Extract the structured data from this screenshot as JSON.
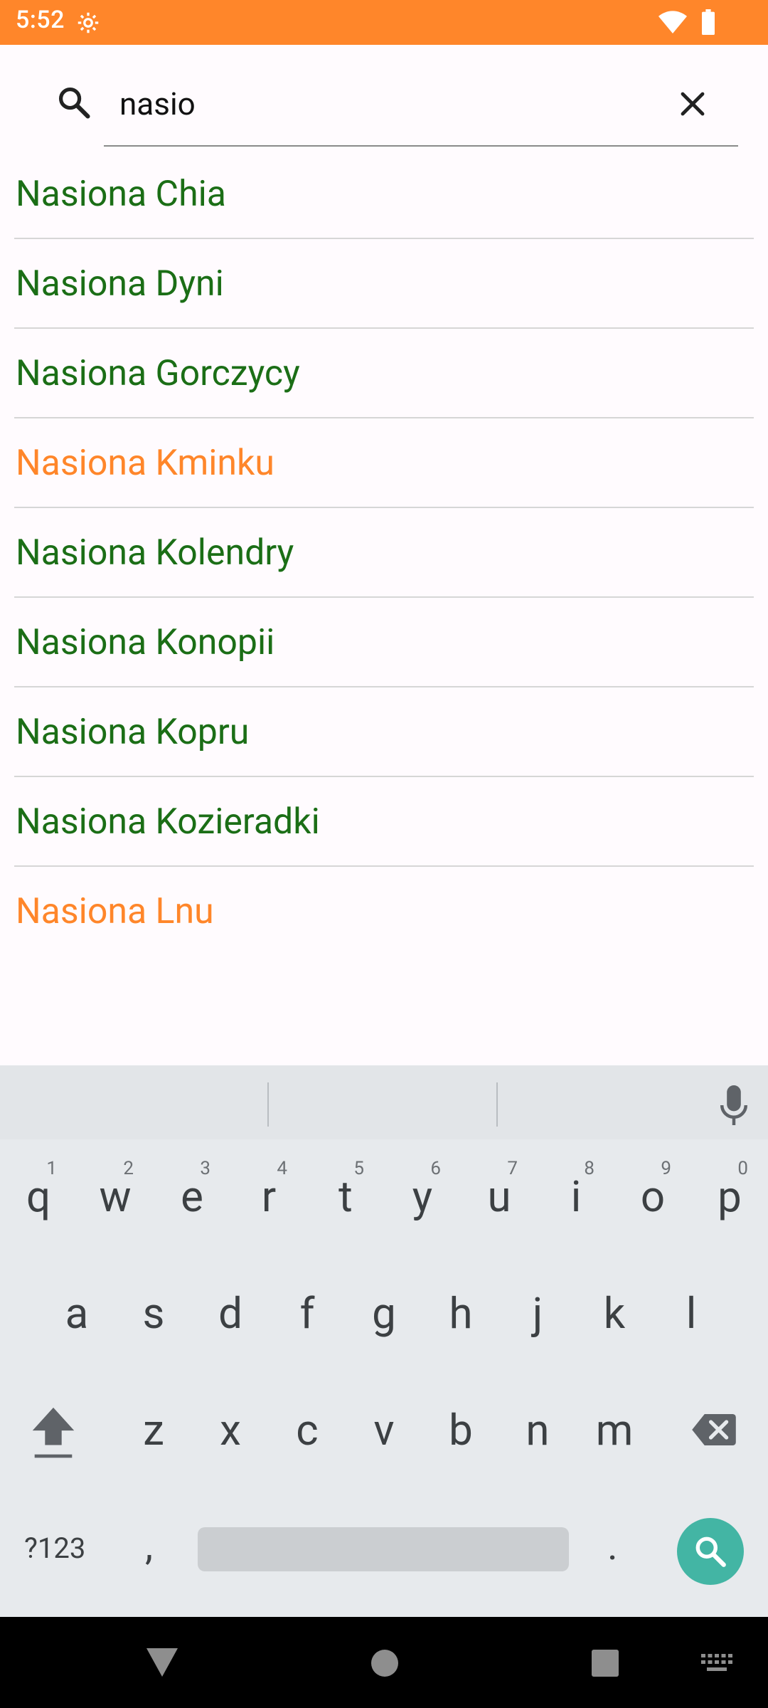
{
  "status_bar": {
    "time": "5:52"
  },
  "search": {
    "query": "nasio"
  },
  "results": [
    {
      "label": "Nasiona Chia",
      "color": "#1b6e16"
    },
    {
      "label": "Nasiona Dyni",
      "color": "#1b6e16"
    },
    {
      "label": "Nasiona Gorczycy",
      "color": "#1b6e16"
    },
    {
      "label": "Nasiona Kminku",
      "color": "#ff862a"
    },
    {
      "label": "Nasiona Kolendry",
      "color": "#1b6e16"
    },
    {
      "label": "Nasiona Konopii",
      "color": "#1b6e16"
    },
    {
      "label": "Nasiona Kopru",
      "color": "#1b6e16"
    },
    {
      "label": "Nasiona Kozieradki",
      "color": "#1b6e16"
    },
    {
      "label": "Nasiona Lnu",
      "color": "#ff862a"
    }
  ],
  "keyboard": {
    "row1": [
      {
        "k": "q",
        "n": "1"
      },
      {
        "k": "w",
        "n": "2"
      },
      {
        "k": "e",
        "n": "3"
      },
      {
        "k": "r",
        "n": "4"
      },
      {
        "k": "t",
        "n": "5"
      },
      {
        "k": "y",
        "n": "6"
      },
      {
        "k": "u",
        "n": "7"
      },
      {
        "k": "i",
        "n": "8"
      },
      {
        "k": "o",
        "n": "9"
      },
      {
        "k": "p",
        "n": "0"
      }
    ],
    "row2": [
      "a",
      "s",
      "d",
      "f",
      "g",
      "h",
      "j",
      "k",
      "l"
    ],
    "row3": [
      "z",
      "x",
      "c",
      "v",
      "b",
      "n",
      "m"
    ],
    "symbols_label": "?123",
    "comma": ",",
    "period": "."
  },
  "colors": {
    "status_bar": "#ff862a",
    "item_default": "#1b6e16",
    "item_highlight": "#ff862a",
    "keyboard_action": "#43b5a4"
  }
}
